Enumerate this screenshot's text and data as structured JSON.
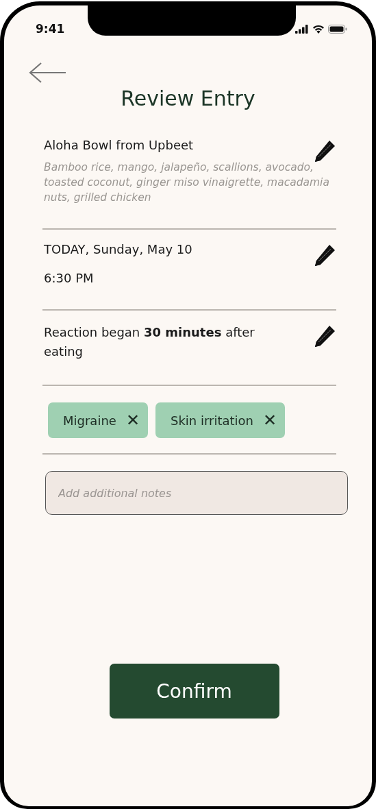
{
  "status_bar": {
    "time": "9:41"
  },
  "title": "Review Entry",
  "entries": [
    {
      "kind": "food",
      "title": "Aloha Bowl from Upbeet",
      "description": "Bamboo rice, mango, jalapeño, scallions, avocado, toasted coconut, ginger miso vinaigrette, macadamia nuts, grilled chicken"
    },
    {
      "kind": "datetime",
      "date": "TODAY, Sunday, May 10",
      "time": "6:30 PM"
    },
    {
      "kind": "reaction",
      "text": "Reaction began **30 minutes** after eating"
    }
  ],
  "symptoms": [
    {
      "label": "Migraine",
      "remove": "✕"
    },
    {
      "label": "Skin irritation",
      "remove": "✕"
    }
  ],
  "notes": {
    "placeholder": "Add additional notes"
  },
  "confirm_button": "Confirm"
}
